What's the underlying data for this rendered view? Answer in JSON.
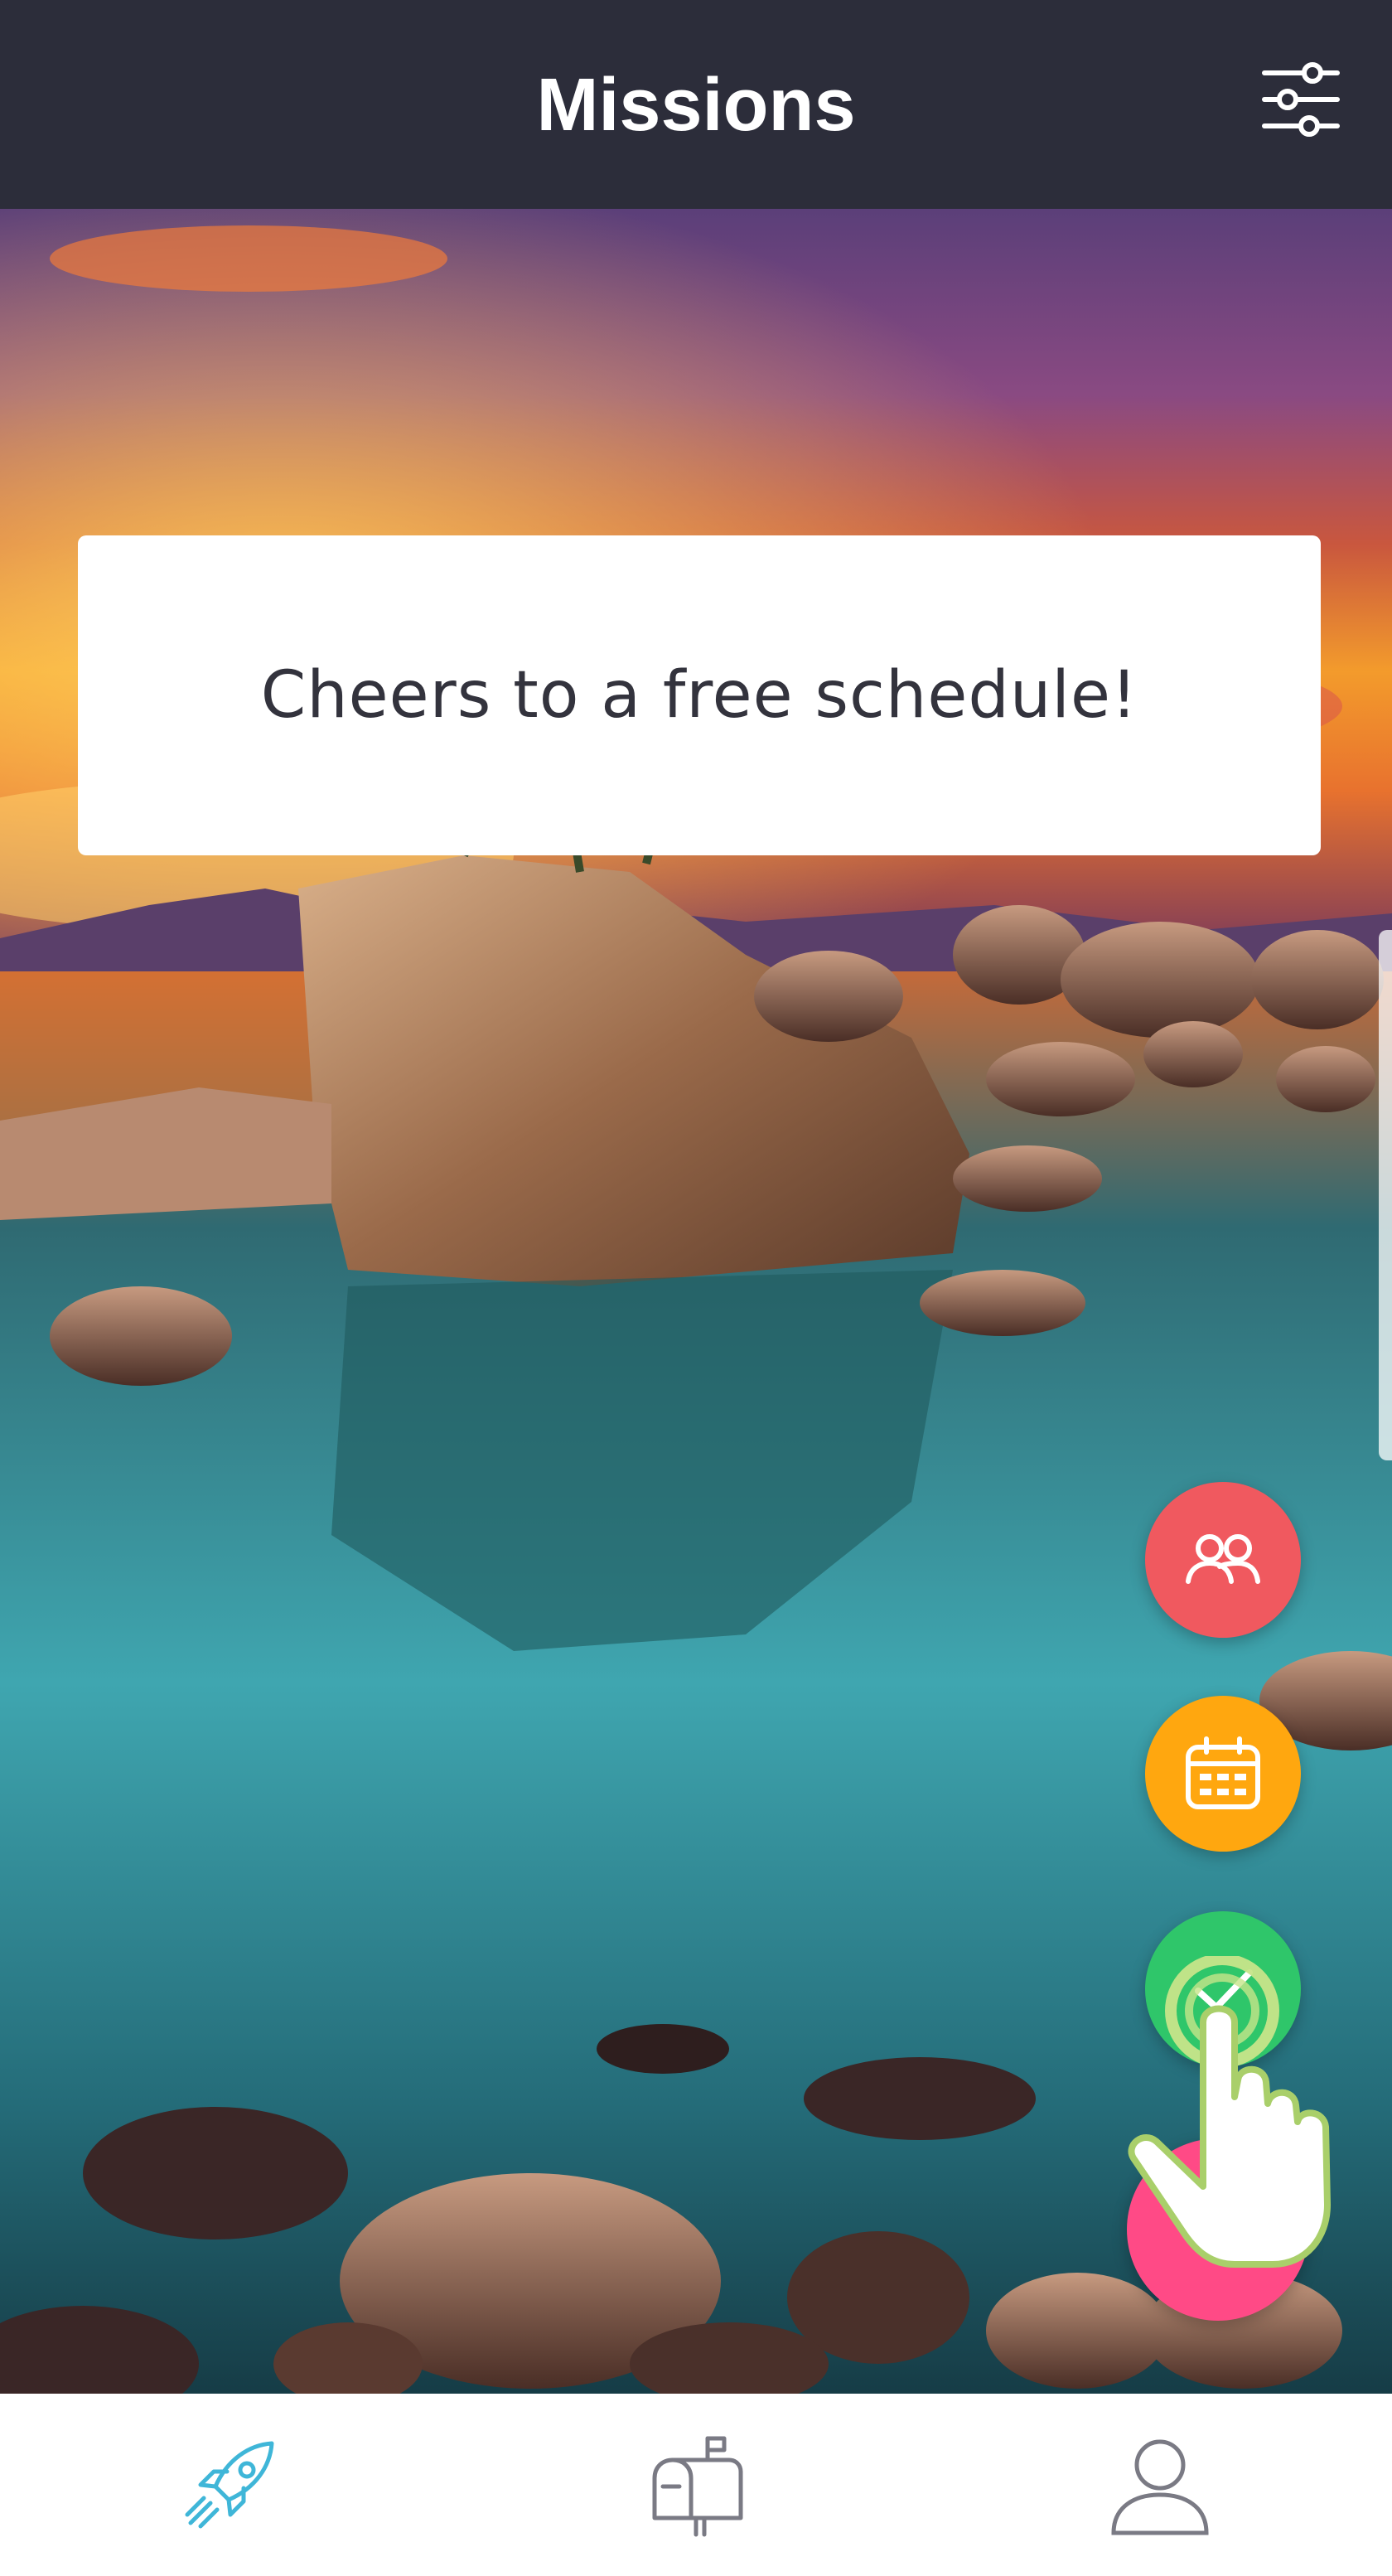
{
  "header": {
    "title": "Missions",
    "filter_icon": "sliders-icon"
  },
  "banner": {
    "message": "Cheers to a free schedule!"
  },
  "background": {
    "subject": "sunset-lake-rocks-photo"
  },
  "fabs": [
    {
      "name": "team",
      "icon": "people-icon",
      "color": "#f0595f"
    },
    {
      "name": "calendar",
      "icon": "calendar-icon",
      "color": "#ffa70f"
    },
    {
      "name": "task",
      "icon": "checkmark-icon",
      "color": "#2fc66a"
    },
    {
      "name": "add",
      "icon": "plus-icon",
      "color": "#ff4a86"
    }
  ],
  "tabbar": {
    "items": [
      {
        "name": "missions",
        "icon": "rocket-icon",
        "active": true,
        "color": "#3fb6d8"
      },
      {
        "name": "inbox",
        "icon": "mailbox-icon",
        "active": false,
        "color": "#7a7a84"
      },
      {
        "name": "profile",
        "icon": "person-icon",
        "active": false,
        "color": "#7a7a84"
      }
    ]
  },
  "colors": {
    "header_bg": "#2c2d3a",
    "card_bg": "#ffffff",
    "tabbar_bg": "#ffffff"
  }
}
